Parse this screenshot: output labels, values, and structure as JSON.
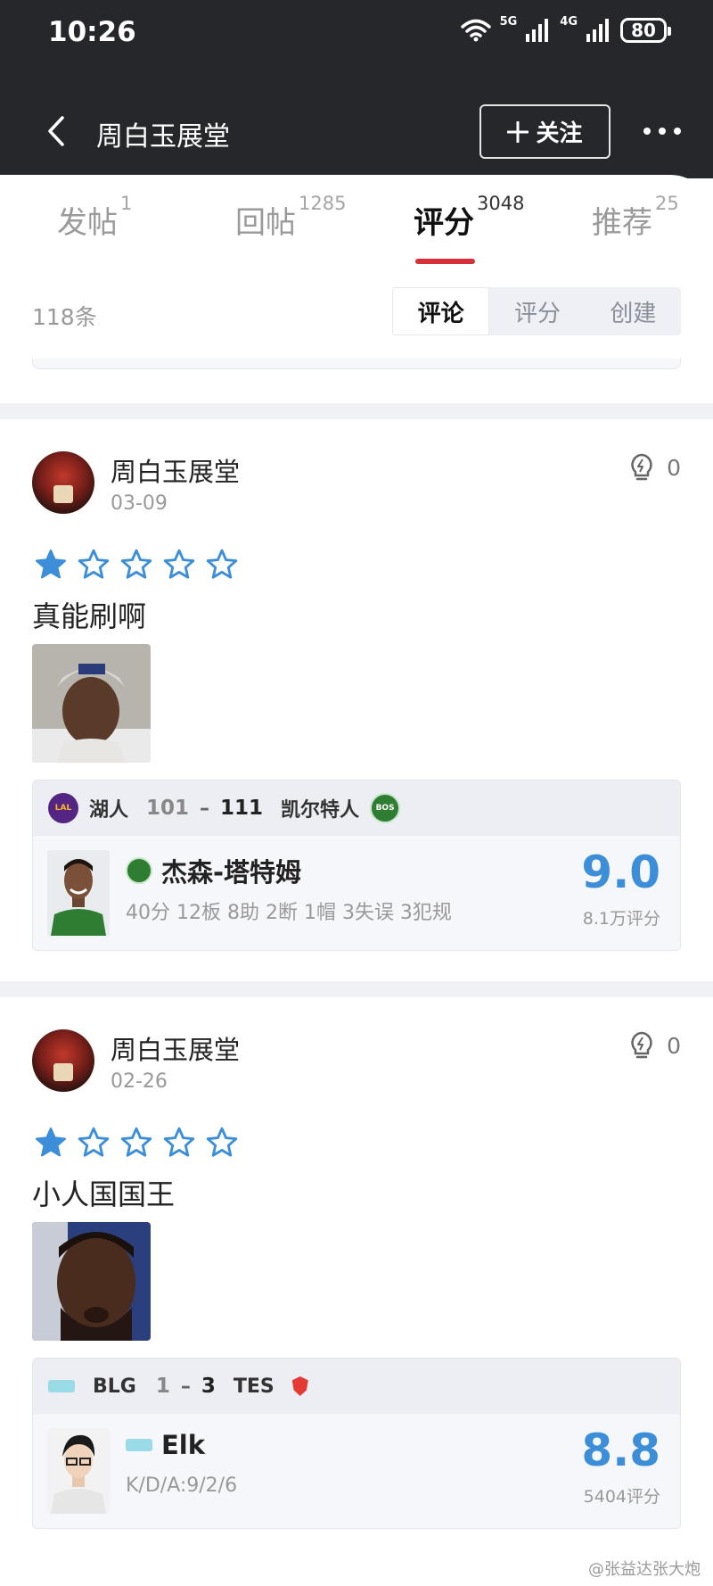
{
  "status": {
    "time": "10:26",
    "net1": "5G",
    "net2": "4G",
    "battery": "80"
  },
  "header": {
    "title": "周白玉展堂",
    "follow_label": "关注"
  },
  "tabs": [
    {
      "label": "发帖",
      "count": "1"
    },
    {
      "label": "回帖",
      "count": "1285"
    },
    {
      "label": "评分",
      "count": "3048"
    },
    {
      "label": "推荐",
      "count": "25"
    }
  ],
  "list": {
    "count": "118条"
  },
  "segments": [
    "评论",
    "评分",
    "创建"
  ],
  "comments": [
    {
      "user": "周白玉展堂",
      "date": "03-09",
      "likes": "0",
      "stars": 1,
      "text": "真能刷啊",
      "match": {
        "home": "湖人",
        "home_score": "101",
        "away_score": "111",
        "away": "凯尔特人",
        "player": "杰森-塔特姆",
        "statline": "40分 12板 8助 2断 1帽 3失误 3犯规",
        "rating": "9.0",
        "rating_count": "8.1万评分",
        "home_logo": "LAL",
        "away_logo": "BOS"
      }
    },
    {
      "user": "周白玉展堂",
      "date": "02-26",
      "likes": "0",
      "stars": 1,
      "text": "小人国国王",
      "match": {
        "home": "BLG",
        "home_score": "1",
        "away_score": "3",
        "away": "TES",
        "player": "Elk",
        "statline": "K/D/A:9/2/6",
        "rating": "8.8",
        "rating_count": "5404评分"
      }
    }
  ],
  "watermark": "@张益达张大炮",
  "colors": {
    "accent": "#d6303b",
    "rating": "#3d8ed8",
    "header_bg": "#25272b"
  }
}
